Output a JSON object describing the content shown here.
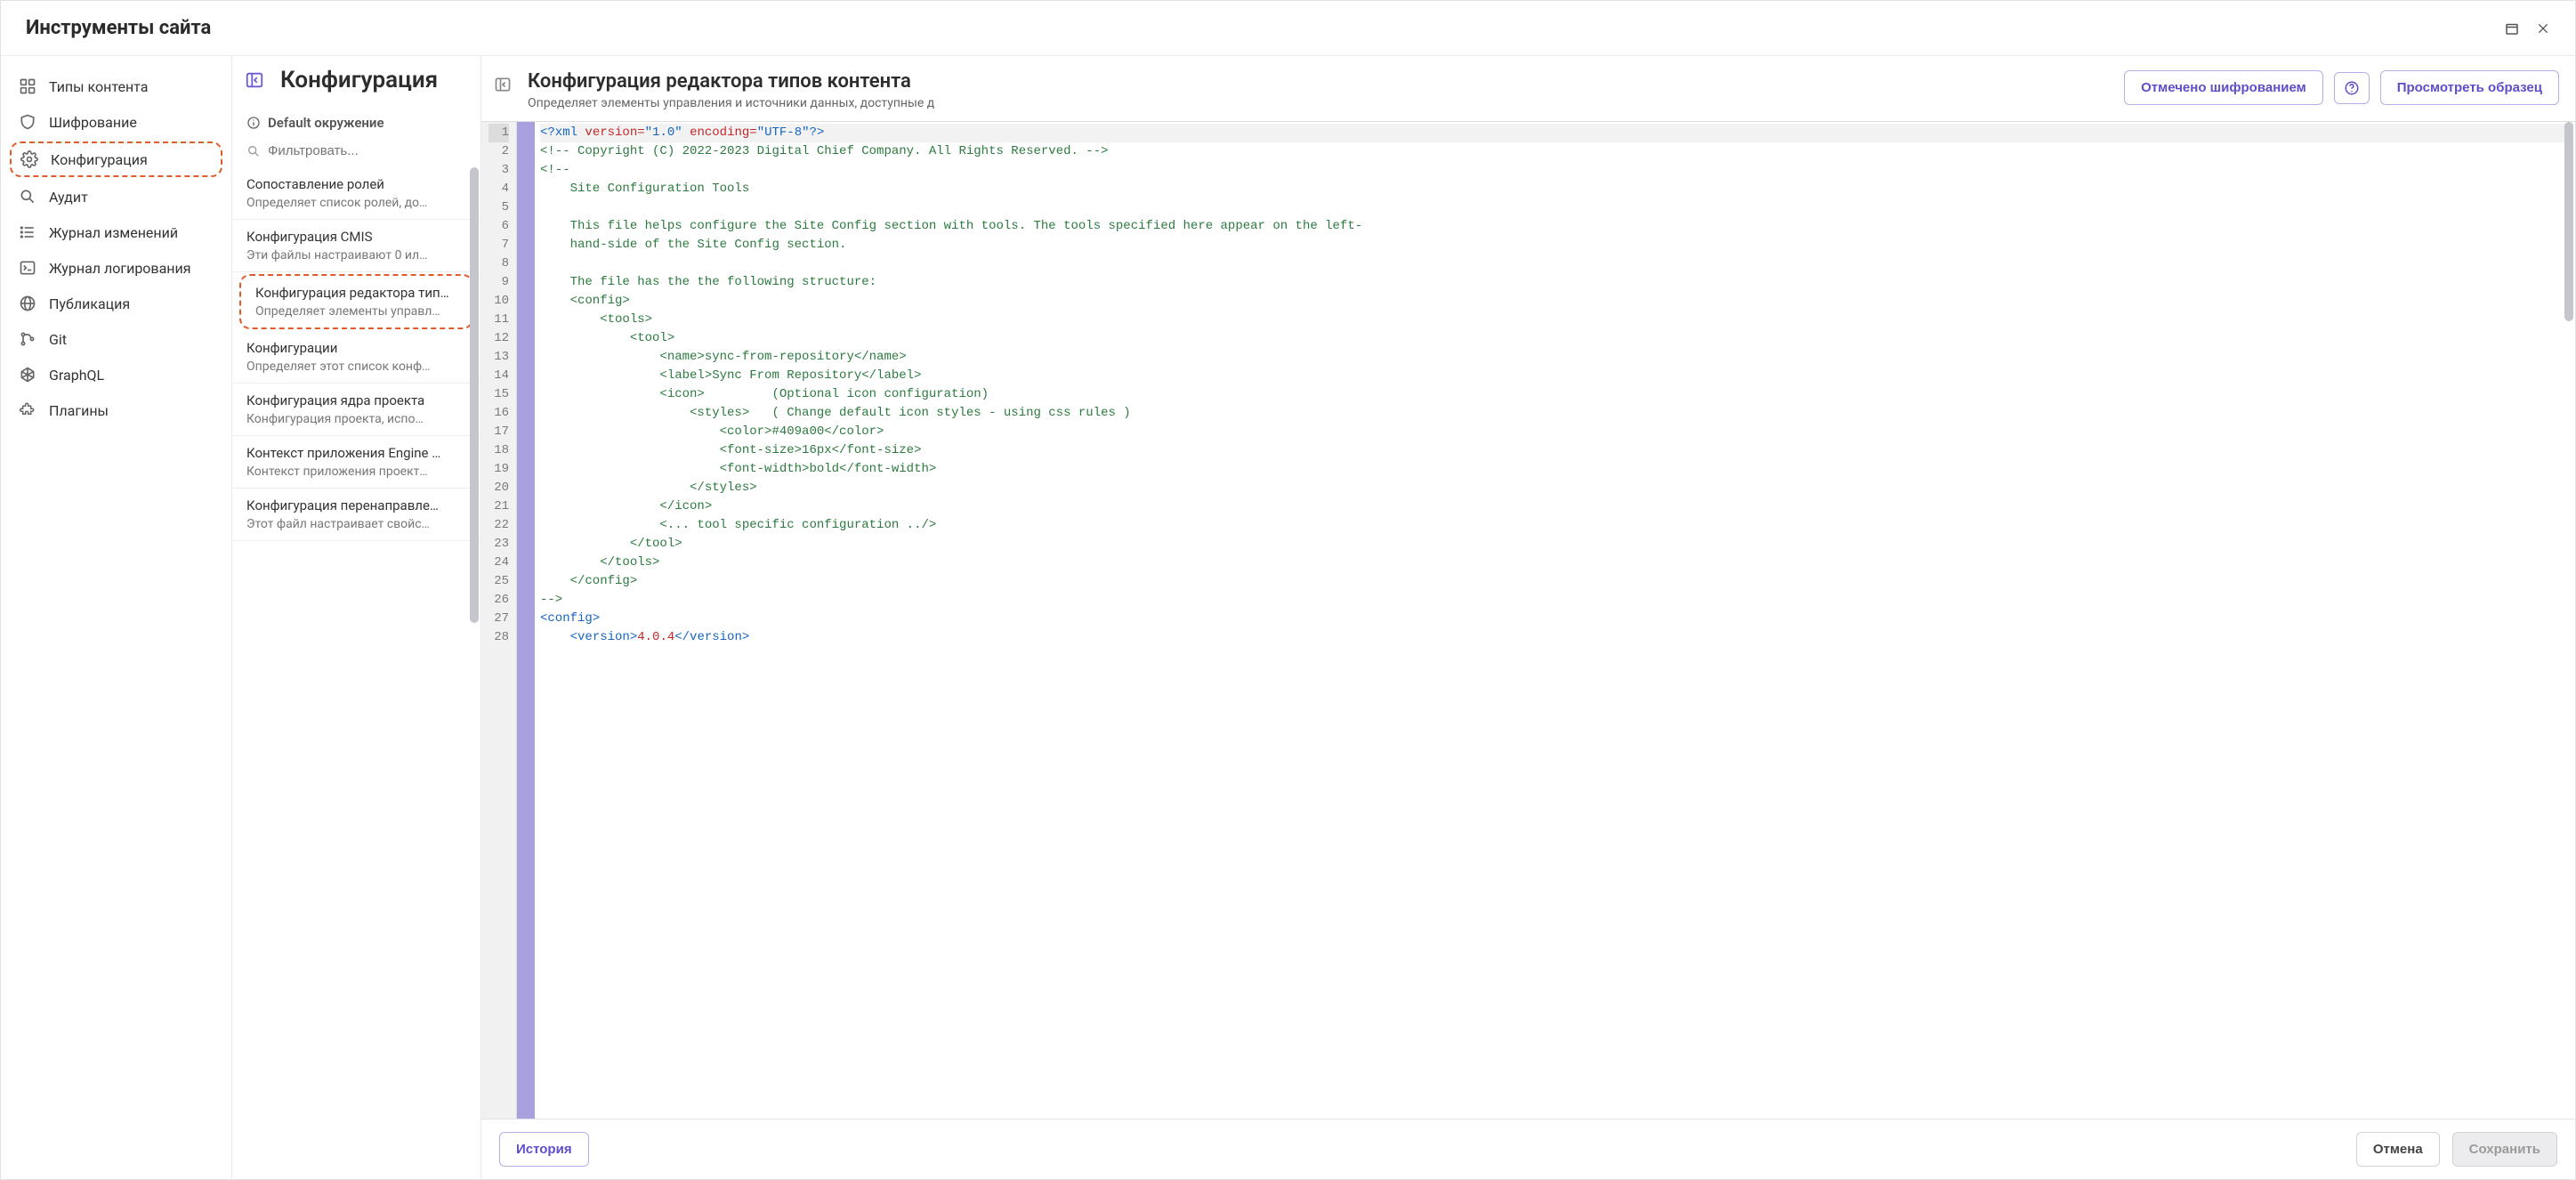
{
  "title": "Инструменты сайта",
  "nav": [
    {
      "icon": "grid",
      "label": "Типы контента"
    },
    {
      "icon": "shield",
      "label": "Шифрование"
    },
    {
      "icon": "gear",
      "label": "Конфигурация",
      "highlight": true
    },
    {
      "icon": "search",
      "label": "Аудит"
    },
    {
      "icon": "list",
      "label": "Журнал изменений"
    },
    {
      "icon": "terminal",
      "label": "Журнал логирования"
    },
    {
      "icon": "globe",
      "label": "Публикация"
    },
    {
      "icon": "git",
      "label": "Git"
    },
    {
      "icon": "graphql",
      "label": "GraphQL"
    },
    {
      "icon": "puzzle",
      "label": "Плагины"
    }
  ],
  "main_heading": "Конфигурация",
  "env_label": "Default окружение",
  "filter_placeholder": "Фильтровать...",
  "mid_items": [
    {
      "title": "Сопоставление ролей",
      "desc": "Определяет список ролей, до…"
    },
    {
      "title": "Конфигурация CMIS",
      "desc": "Эти файлы настраивают 0 ил…"
    },
    {
      "title": "Конфигурация редактора тип…",
      "desc": "Определяет элементы управл…",
      "highlight": true
    },
    {
      "title": "Конфигурации",
      "desc": "Определяет этот список конф…"
    },
    {
      "title": "Конфигурация ядра проекта",
      "desc": "Конфигурация проекта, испо…"
    },
    {
      "title": "Контекст приложения Engine …",
      "desc": "Контекст приложения проект…"
    },
    {
      "title": "Конфигурация перенаправле…",
      "desc": "Этот файл настраивает свойс…"
    }
  ],
  "detail": {
    "title": "Конфигурация редактора типов контента",
    "subtitle": "Определяет элементы управления и источники данных, доступные д",
    "btn_encrypt": "Отмечено шифрованием",
    "btn_sample": "Просмотреть образец"
  },
  "footer": {
    "history": "История",
    "cancel": "Отмена",
    "save": "Сохранить"
  },
  "code_lines": [
    {
      "n": 1,
      "html": "<span class='c-prolog'>&lt;?xml</span> <span class='c-attr'>version=</span><span class='c-str'>\"1.0\"</span> <span class='c-attr'>encoding=</span><span class='c-str'>\"UTF-8\"</span><span class='c-prolog'>?&gt;</span>",
      "hl": true
    },
    {
      "n": 2,
      "html": "<span class='c-cm'>&lt;!-- Copyright (C) 2022-2023 Digital Chief Company. All Rights Reserved. --&gt;</span>"
    },
    {
      "n": 3,
      "html": "<span class='c-cm'>&lt;!--</span>"
    },
    {
      "n": 4,
      "html": "<span class='c-cm'>    Site Configuration Tools</span>"
    },
    {
      "n": 5,
      "html": "<span class='c-cm'> </span>"
    },
    {
      "n": 6,
      "html": "<span class='c-cm'>    This file helps configure the Site Config section with tools. The tools specified here appear on the left-</span>"
    },
    {
      "n": 7,
      "html": "<span class='c-cm'>    hand-side of the Site Config section.</span>"
    },
    {
      "n": 8,
      "html": "<span class='c-cm'> </span>"
    },
    {
      "n": 9,
      "html": "<span class='c-cm'>    The file has the the following structure:</span>"
    },
    {
      "n": 10,
      "html": "<span class='c-cm'>    &lt;config&gt;</span>"
    },
    {
      "n": 11,
      "html": "<span class='c-cm'>        &lt;tools&gt;</span>"
    },
    {
      "n": 12,
      "html": "<span class='c-cm'>            &lt;tool&gt;</span>"
    },
    {
      "n": 13,
      "html": "<span class='c-cm'>                &lt;name&gt;sync-from-repository&lt;/name&gt;</span>"
    },
    {
      "n": 14,
      "html": "<span class='c-cm'>                &lt;label&gt;Sync From Repository&lt;/label&gt;</span>"
    },
    {
      "n": 15,
      "html": "<span class='c-cm'>                &lt;icon&gt;         (Optional icon configuration)</span>"
    },
    {
      "n": 16,
      "html": "<span class='c-cm'>                    &lt;styles&gt;   ( Change default icon styles - using css rules )</span>"
    },
    {
      "n": 17,
      "html": "<span class='c-cm'>                        &lt;color&gt;#409a00&lt;/color&gt;</span>"
    },
    {
      "n": 18,
      "html": "<span class='c-cm'>                        &lt;font-size&gt;16px&lt;/font-size&gt;</span>"
    },
    {
      "n": 19,
      "html": "<span class='c-cm'>                        &lt;font-width&gt;bold&lt;/font-width&gt;</span>"
    },
    {
      "n": 20,
      "html": "<span class='c-cm'>                    &lt;/styles&gt;</span>"
    },
    {
      "n": 21,
      "html": "<span class='c-cm'>                &lt;/icon&gt;</span>"
    },
    {
      "n": 22,
      "html": "<span class='c-cm'>                &lt;... tool specific configuration ../&gt;</span>"
    },
    {
      "n": 23,
      "html": "<span class='c-cm'>            &lt;/tool&gt;</span>"
    },
    {
      "n": 24,
      "html": "<span class='c-cm'>        &lt;/tools&gt;</span>"
    },
    {
      "n": 25,
      "html": "<span class='c-cm'>    &lt;/config&gt;</span>"
    },
    {
      "n": 26,
      "html": "<span class='c-cm'>--&gt;</span>"
    },
    {
      "n": 27,
      "html": "<span class='c-tag'>&lt;config&gt;</span>"
    },
    {
      "n": 28,
      "html": "    <span class='c-tag'>&lt;version&gt;</span><span class='c-txt'>4.0.4</span><span class='c-tag'>&lt;/version&gt;</span>"
    }
  ]
}
